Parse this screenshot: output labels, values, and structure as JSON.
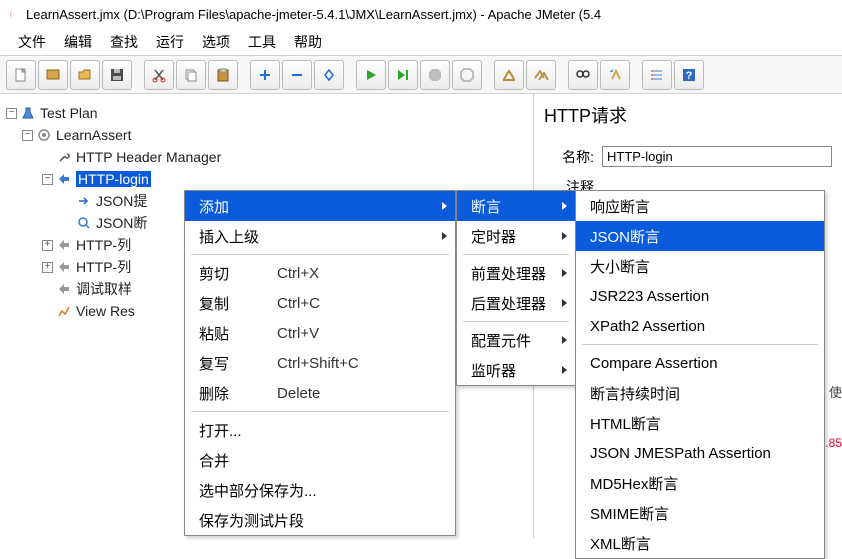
{
  "titlebar": {
    "text": "LearnAssert.jmx (D:\\Program Files\\apache-jmeter-5.4.1\\JMX\\LearnAssert.jmx) - Apache JMeter (5.4"
  },
  "menu": {
    "file": "文件",
    "edit": "编辑",
    "search": "查找",
    "run": "运行",
    "options": "选项",
    "tools": "工具",
    "help": "帮助"
  },
  "tree": {
    "root": "Test Plan",
    "n1": "LearnAssert",
    "n2": "HTTP Header Manager",
    "n3": "HTTP-login",
    "n4": "JSON提",
    "n5": "JSON断",
    "n6": "HTTP-列",
    "n7": "HTTP-列",
    "n8": "调试取样",
    "n9": "View Res"
  },
  "right": {
    "title": "HTTP请求",
    "name_label": "名称:",
    "name_value": "HTTP-login",
    "comment_label": "注释",
    "partial1": "使",
    "partial2": ".85"
  },
  "ctx_main": {
    "add": "添加",
    "insert": "插入上级",
    "cut": "剪切",
    "cut_k": "Ctrl+X",
    "copy": "复制",
    "copy_k": "Ctrl+C",
    "paste": "粘贴",
    "paste_k": "Ctrl+V",
    "dup": "复写",
    "dup_k": "Ctrl+Shift+C",
    "del": "删除",
    "del_k": "Delete",
    "open": "打开...",
    "merge": "合并",
    "save_sel": "选中部分保存为...",
    "save_frag": "保存为测试片段"
  },
  "ctx_sub1": {
    "assert": "断言",
    "timer": "定时器",
    "pre": "前置处理器",
    "post": "后置处理器",
    "config": "配置元件",
    "listener": "监听器"
  },
  "ctx_sub2": {
    "resp": "响应断言",
    "json": "JSON断言",
    "size": "大小断言",
    "jsr": "JSR223 Assertion",
    "xpath": "XPath2 Assertion",
    "compare": "Compare Assertion",
    "duration": "断言持续时间",
    "html": "HTML断言",
    "jmes": "JSON JMESPath Assertion",
    "md5": "MD5Hex断言",
    "smime": "SMIME断言",
    "xml": "XML断言"
  }
}
